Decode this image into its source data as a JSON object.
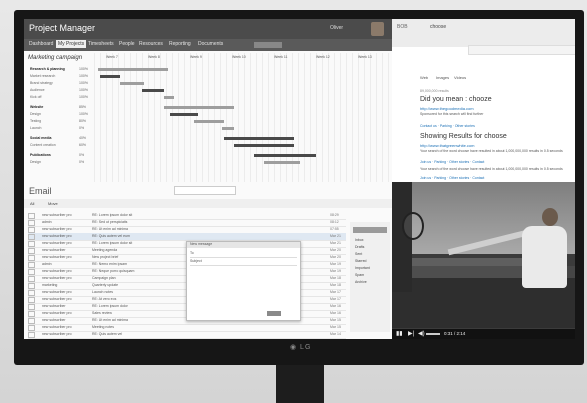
{
  "project_manager": {
    "app_title": "Project Manager",
    "user_name": "Oliver",
    "nav_tabs": [
      "Dashboard",
      "My Projects",
      "Timesheets",
      "People",
      "Resources",
      "Reporting",
      "Documents"
    ],
    "active_tab": "My Projects",
    "board_title": "Marketing campaign",
    "weeks": [
      "Week 7",
      "Week 8",
      "Week 9",
      "Week 10",
      "Week 11",
      "Week 12",
      "Week 13"
    ],
    "tasks": [
      {
        "name": "Research & planning",
        "pct": "100%",
        "group": true
      },
      {
        "name": "Market research",
        "pct": "100%",
        "group": false
      },
      {
        "name": "Brand strategy",
        "pct": "100%",
        "group": false
      },
      {
        "name": "Audience",
        "pct": "100%",
        "group": false
      },
      {
        "name": "Kick off",
        "pct": "100%",
        "group": false
      },
      {
        "name": "Website",
        "pct": "85%",
        "group": true
      },
      {
        "name": "Design",
        "pct": "100%",
        "group": false
      },
      {
        "name": "Testing",
        "pct": "80%",
        "group": false
      },
      {
        "name": "Launch",
        "pct": "0%",
        "group": false
      },
      {
        "name": "Social media",
        "pct": "40%",
        "group": true
      },
      {
        "name": "Content creation",
        "pct": "60%",
        "group": false
      },
      {
        "name": "Publications",
        "pct": "0%",
        "group": true
      },
      {
        "name": "Design",
        "pct": "0%",
        "group": false
      }
    ],
    "colors": {
      "titlebar": "#4b4b4b",
      "bar": "#9e9e9e",
      "bar_dark": "#4a4a4a"
    }
  },
  "browser": {
    "brand": "BOB",
    "query": "choose",
    "tabs": [
      "Web",
      "Images",
      "Videos"
    ],
    "stats": "89,000,000 results",
    "did_you_mean": "Did you mean : chooze",
    "result1_url": "http://www.thegoodmedia.com",
    "result1_text": "Sponsored for this search will find further ",
    "result1_sitelinks": "Contact us · Parking · Other stories",
    "showing_results": "Showing Results for choose",
    "result2_url": "http://www.thatgreenwhite.com",
    "result2_text": "Your search of the word choose have resulted in about 1,000,000,000 results in 0.5 seconds",
    "result2_sitelinks": "Join us · Parking · Other stories · Contact",
    "result3_text": "Your search of the word choose have resulted in about 1,000,000,000 results in 0.5 seconds",
    "result3_sitelinks": "Join us · Parking · Other stories · Contact"
  },
  "email": {
    "title": "Email",
    "toolbar": [
      "All",
      "Move"
    ],
    "rows": [
      {
        "from": "new subscriber pro",
        "subject": "RE: Lorem ipsum dolor sit",
        "date": "08:29"
      },
      {
        "from": "admin",
        "subject": "RE: Sed ut perspiciatis",
        "date": "08:12"
      },
      {
        "from": "new subscriber pro",
        "subject": "RE: Ut enim ad minima",
        "date": "07:55"
      },
      {
        "from": "new subscriber pro",
        "subject": "RE: Quis autem vel eum",
        "date": "Mar 21"
      },
      {
        "from": "new subscriber pro",
        "subject": "RE: Lorem ipsum dolor sit",
        "date": "Mar 21"
      },
      {
        "from": "new subscriber",
        "subject": "Meeting agenda",
        "date": "Mar 20"
      },
      {
        "from": "new subscriber pro",
        "subject": "New project brief",
        "date": "Mar 20"
      },
      {
        "from": "admin",
        "subject": "RE: Nemo enim ipsam",
        "date": "Mar 19"
      },
      {
        "from": "new subscriber pro",
        "subject": "RE: Neque porro quisquam",
        "date": "Mar 19"
      },
      {
        "from": "new subscriber pro",
        "subject": "Campaign plan",
        "date": "Mar 18"
      },
      {
        "from": "marketing",
        "subject": "Quarterly update",
        "date": "Mar 18"
      },
      {
        "from": "new subscriber pro",
        "subject": "Launch notes",
        "date": "Mar 17"
      },
      {
        "from": "new subscriber pro",
        "subject": "RE: At vero eos",
        "date": "Mar 17"
      },
      {
        "from": "new subscriber",
        "subject": "RE: Lorem ipsum dolor",
        "date": "Mar 16"
      },
      {
        "from": "new subscriber pro",
        "subject": "Sales review",
        "date": "Mar 16"
      },
      {
        "from": "new subscriber",
        "subject": "RE: Ut enim ad minima",
        "date": "Mar 15"
      },
      {
        "from": "new subscriber pro",
        "subject": "Meeting notes",
        "date": "Mar 15"
      },
      {
        "from": "new subscriber pro",
        "subject": "RE: Quis autem vel",
        "date": "Mar 14"
      }
    ],
    "folders": [
      "Inbox",
      "Drafts",
      "Sent",
      "Starred",
      "Important",
      "Spam",
      "Archive"
    ],
    "compose_label": "New message",
    "compose_fields": [
      "To",
      "Subject"
    ]
  },
  "video": {
    "time": "0:31 / 2:14",
    "progress": 0.23
  }
}
